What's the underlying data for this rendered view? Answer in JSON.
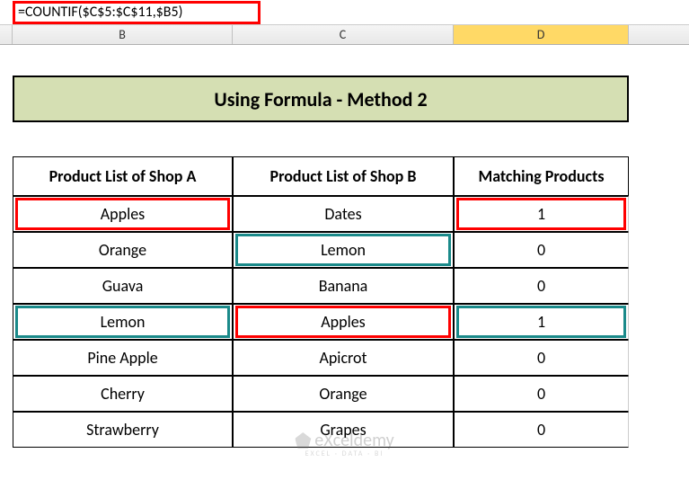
{
  "formula_bar": {
    "formula": "=COUNTIF($C$5:$C$11,$B5)"
  },
  "columns": {
    "b": "B",
    "c": "C",
    "d": "D"
  },
  "title": "Using Formula - Method 2",
  "headers": {
    "shop_a": "Product List of Shop A",
    "shop_b": "Product List of Shop B",
    "matching": "Matching Products"
  },
  "rows": [
    {
      "a": "Apples",
      "b": "Dates",
      "m": "1"
    },
    {
      "a": "Orange",
      "b": "Lemon",
      "m": "0"
    },
    {
      "a": "Guava",
      "b": "Banana",
      "m": "0"
    },
    {
      "a": "Lemon",
      "b": "Apples",
      "m": "1"
    },
    {
      "a": "Pine Apple",
      "b": "Apicrot",
      "m": "0"
    },
    {
      "a": "Cherry",
      "b": "Orange",
      "m": "0"
    },
    {
      "a": "Strawberry",
      "b": "Grapes",
      "m": "0"
    }
  ],
  "watermark": {
    "brand": "eXceldemy",
    "tagline": "EXCEL · DATA · BI"
  },
  "chart_data": {
    "type": "table",
    "title": "Using Formula - Method 2",
    "columns": [
      "Product List of Shop A",
      "Product List of Shop B",
      "Matching Products"
    ],
    "rows": [
      [
        "Apples",
        "Dates",
        1
      ],
      [
        "Orange",
        "Lemon",
        0
      ],
      [
        "Guava",
        "Banana",
        0
      ],
      [
        "Lemon",
        "Apples",
        1
      ],
      [
        "Pine Apple",
        "Apicrot",
        0
      ],
      [
        "Cherry",
        "Orange",
        0
      ],
      [
        "Strawberry",
        "Grapes",
        0
      ]
    ]
  }
}
